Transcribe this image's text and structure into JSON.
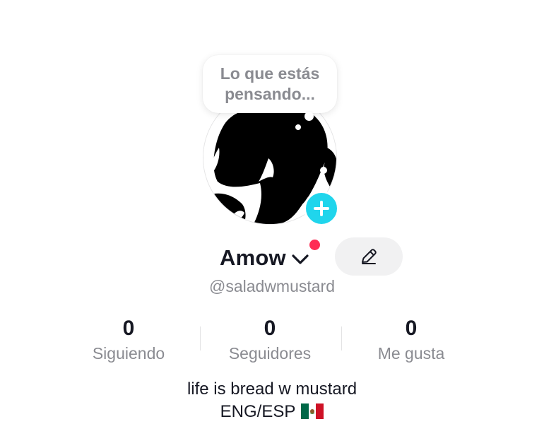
{
  "profile": {
    "thought_bubble": {
      "line1": "Lo que estás",
      "line2": "pensando..."
    },
    "display_name": "Amow",
    "username": "@saladwmustard",
    "has_notification": true,
    "accent_colors": {
      "add_button": "#20d5ec",
      "notification_dot": "#fe2c55",
      "edit_button_bg": "#f1f1f2"
    }
  },
  "stats": [
    {
      "value": "0",
      "label": "Siguiendo"
    },
    {
      "value": "0",
      "label": "Seguidores"
    },
    {
      "value": "0",
      "label": "Me gusta"
    }
  ],
  "bio": {
    "line1": "life is bread w mustard",
    "line2": "ENG/ESP",
    "flag": "mexico-flag"
  },
  "icons": {
    "add": "plus-icon",
    "switch_account": "chevron-down-icon",
    "edit": "pencil-icon"
  }
}
